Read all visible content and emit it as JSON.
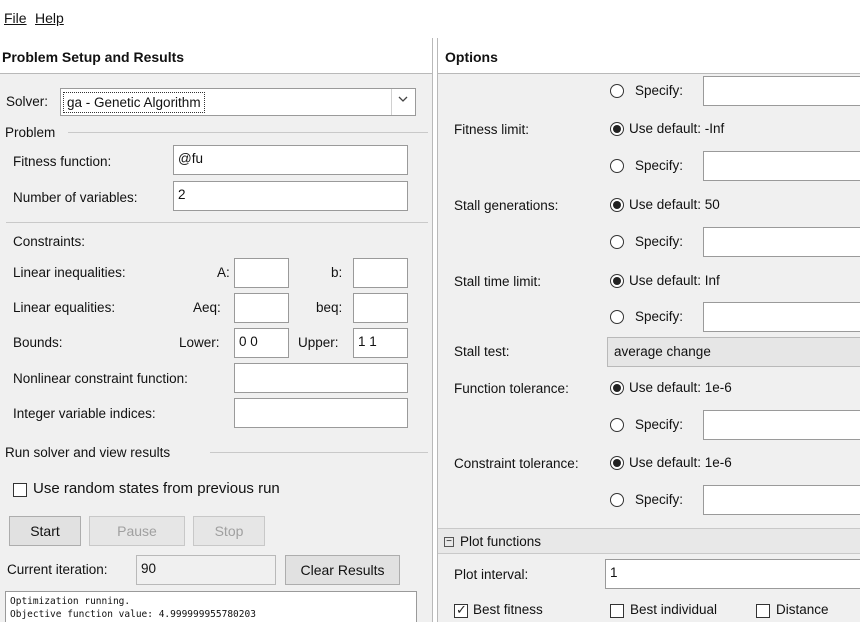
{
  "menu": {
    "file": "File",
    "help": "Help"
  },
  "left": {
    "header": "Problem Setup and Results",
    "solver_label": "Solver:",
    "solver_value": "ga - Genetic Algorithm",
    "problem": {
      "title": "Problem",
      "fitness_label": "Fitness function:",
      "fitness_value": "@fu",
      "nvars_label": "Number of variables:",
      "nvars_value": "2"
    },
    "constraints": {
      "title": "Constraints:",
      "lin_ineq_label": "Linear inequalities:",
      "a_label": "A:",
      "a_value": "",
      "b_label": "b:",
      "b_value": "",
      "lin_eq_label": "Linear equalities:",
      "aeq_label": "Aeq:",
      "aeq_value": "",
      "beq_label": "beq:",
      "beq_value": "",
      "bounds_label": "Bounds:",
      "lower_label": "Lower:",
      "lower_value": "0 0",
      "upper_label": "Upper:",
      "upper_value": "1 1",
      "nonlin_label": "Nonlinear constraint function:",
      "nonlin_value": "",
      "int_label": "Integer variable indices:",
      "int_value": ""
    },
    "run": {
      "title": "Run solver and view results",
      "random_states_label": "Use random states from previous run",
      "random_states_checked": false,
      "start": "Start",
      "pause": "Pause",
      "stop": "Stop",
      "iteration_label": "Current iteration:",
      "iteration_value": "90",
      "clear": "Clear Results",
      "output_line1": "Optimization running.",
      "output_line2": "Objective function value: 4.999999955780203"
    }
  },
  "right": {
    "header": "Options",
    "specify_label": "Specify:",
    "fitness_limit": {
      "label": "Fitness limit:",
      "default": "Use default: -Inf"
    },
    "stall_generations": {
      "label": "Stall generations:",
      "default": "Use default: 50"
    },
    "stall_time": {
      "label": "Stall time limit:",
      "default": "Use default: Inf"
    },
    "stall_test": {
      "label": "Stall test:",
      "value": "average change"
    },
    "function_tolerance": {
      "label": "Function tolerance:",
      "default": "Use default: 1e-6"
    },
    "constraint_tolerance": {
      "label": "Constraint tolerance:",
      "default": "Use default: 1e-6"
    },
    "plot_functions": {
      "title": "Plot functions",
      "interval_label": "Plot interval:",
      "interval_value": "1",
      "best_fitness": "Best fitness",
      "best_fitness_checked": true,
      "best_individual": "Best individual",
      "best_individual_checked": false,
      "distance": "Distance",
      "distance_checked": false
    }
  }
}
